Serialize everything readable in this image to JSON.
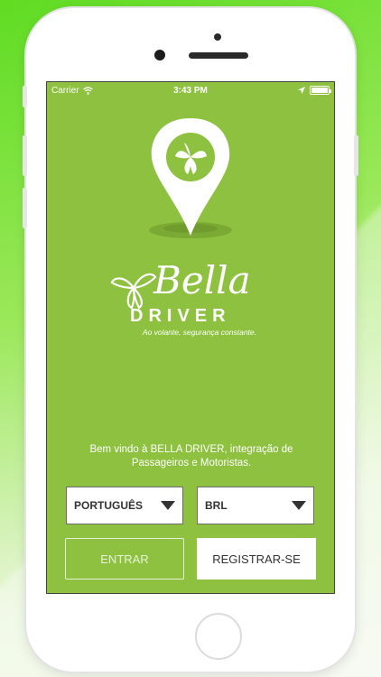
{
  "status_bar": {
    "carrier": "Carrier",
    "time": "3:43 PM"
  },
  "brand": {
    "name": "Bella",
    "subname": "DRIVER",
    "tagline": "Ao volante, segurança constante."
  },
  "welcome_text": "Bem vindo à BELLA DRIVER, integração de Passageiros e Motoristas.",
  "language_select": {
    "value": "PORTUGUÊS"
  },
  "currency_select": {
    "value": "BRL"
  },
  "buttons": {
    "login": "ENTRAR",
    "register": "REGISTRAR-SE"
  },
  "colors": {
    "screen_bg": "#8dc13f",
    "accent_bright": "#5fdc22"
  },
  "icons": [
    "wifi-icon",
    "location-arrow-icon",
    "battery-icon",
    "map-pin-icon",
    "flower-logo-icon",
    "dropdown-arrow-icon"
  ]
}
